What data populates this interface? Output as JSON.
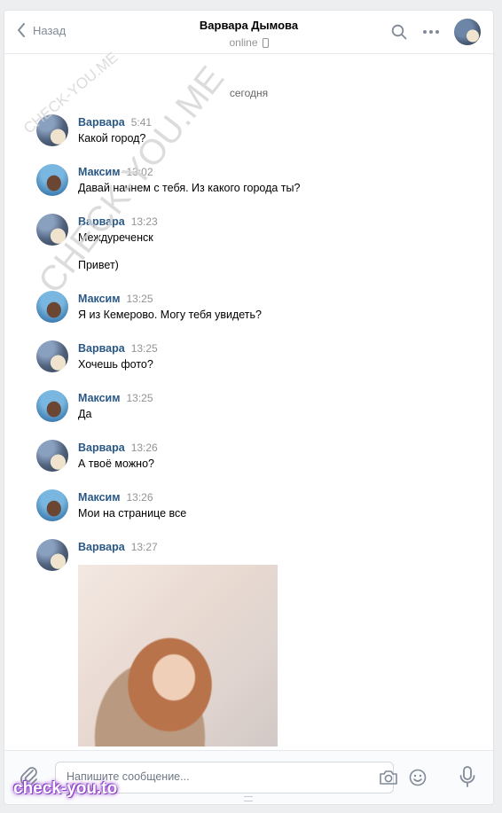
{
  "header": {
    "back_label": "Назад",
    "contact_name": "Варвара Дымова",
    "status": "online"
  },
  "date_separator": "сегодня",
  "messages": [
    {
      "author": "Варвара",
      "time": "5:41",
      "text": "Какой город?",
      "avatar": "varvara"
    },
    {
      "author": "Максим",
      "time": "13:02",
      "text": "Давай начнем с тебя. Из какого города ты?",
      "avatar": "maksim"
    },
    {
      "author": "Варвара",
      "time": "13:23",
      "text": "Междуреченск",
      "text2": "Привет)",
      "avatar": "varvara"
    },
    {
      "author": "Максим",
      "time": "13:25",
      "text": "Я из Кемерово. Могу тебя увидеть?",
      "avatar": "maksim"
    },
    {
      "author": "Варвара",
      "time": "13:25",
      "text": "Хочешь фото?",
      "avatar": "varvara"
    },
    {
      "author": "Максим",
      "time": "13:25",
      "text": "Да",
      "avatar": "maksim"
    },
    {
      "author": "Варвара",
      "time": "13:26",
      "text": "А твоё можно?",
      "avatar": "varvara"
    },
    {
      "author": "Максим",
      "time": "13:26",
      "text": "Мои на странице все",
      "avatar": "maksim"
    },
    {
      "author": "Варвара",
      "time": "13:27",
      "attachment": "photo",
      "avatar": "varvara"
    }
  ],
  "composer": {
    "placeholder": "Напишите сообщение..."
  },
  "watermarks": [
    "CHECK-YOU.ME",
    "CHECK-YOU.ME",
    "check-you.to"
  ],
  "icons": [
    "chevron-left-icon",
    "phone-icon",
    "search-icon",
    "more-icon",
    "paperclip-icon",
    "camera-icon",
    "smile-icon",
    "microphone-icon"
  ],
  "colors": {
    "author": "#2a5885",
    "background": "#edeef0",
    "watermark_brand": "#9b4fd1"
  }
}
